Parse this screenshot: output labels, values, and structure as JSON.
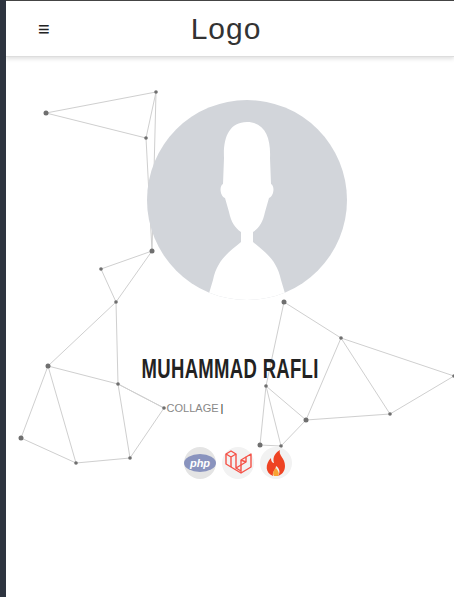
{
  "navbar": {
    "menu_icon": "≡",
    "logo": "Logo"
  },
  "profile": {
    "name": "MUHAMMAD RAFLI",
    "subtitle": "COLLAGE",
    "cursor": "|"
  },
  "skills": [
    {
      "kind": "php",
      "label": "php"
    },
    {
      "kind": "laravel"
    },
    {
      "kind": "codeigniter"
    }
  ]
}
